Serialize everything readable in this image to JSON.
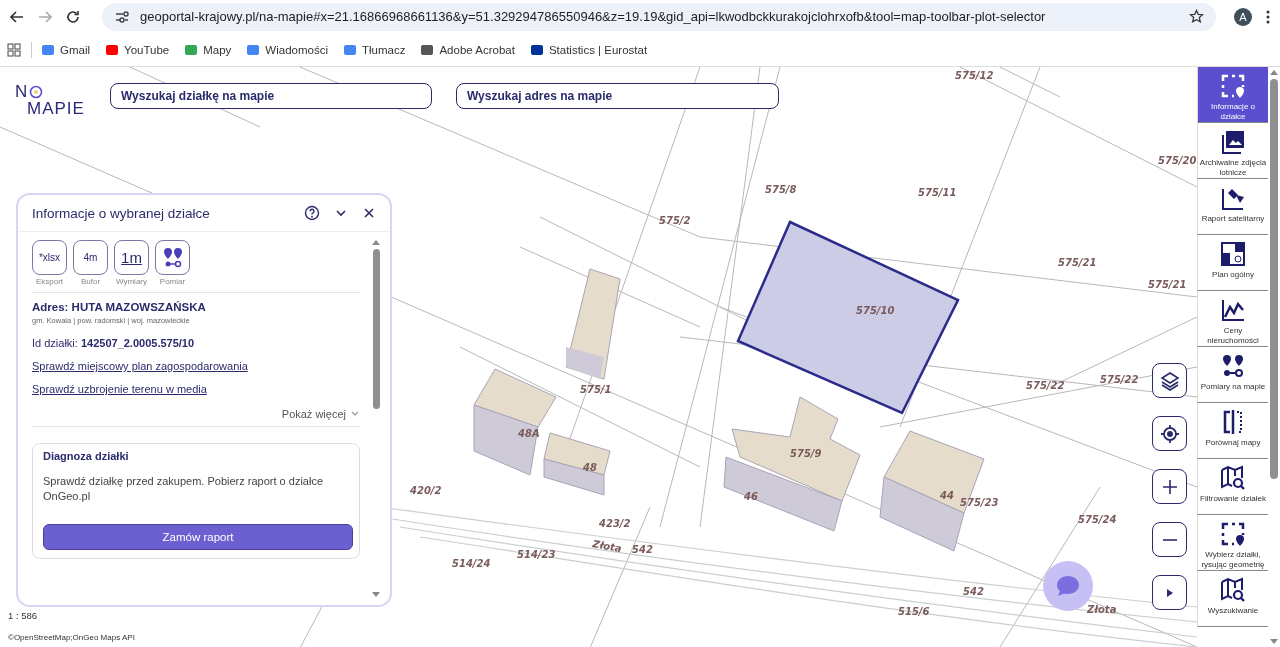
{
  "browser": {
    "url": "geoportal-krajowy.pl/na-mapie#x=21.16866968661136&y=51.329294786550946&z=19.19&gid_api=lkwodbckkurakojclohrxofb&tool=map-toolbar-plot-selector",
    "avatar": "A",
    "bookmarks": [
      "Gmail",
      "YouTube",
      "Mapy",
      "Wiadomości",
      "Tłumacz",
      "Adobe Acrobat",
      "Statistics | Eurostat"
    ]
  },
  "logo": {
    "top": "N",
    "bottom": "MAPIE"
  },
  "search_fields": [
    {
      "placeholder": "Wyszukaj działkę na mapie"
    },
    {
      "placeholder": "Wyszukaj adres na mapie"
    }
  ],
  "panel": {
    "title": "Informacje o wybranej działce",
    "tools": [
      {
        "value": "*xlsx",
        "caption": "Eksport"
      },
      {
        "value": "4m",
        "caption": "Bufor"
      },
      {
        "value": "1m",
        "caption": "Wymiary"
      },
      {
        "caption": "Pomiar"
      }
    ],
    "address": "Adres: HUTA MAZOWSZAŃSKA",
    "region": "gm. Kowala | pow. radomski | woj. mazowieckie",
    "id_label": "Id działki:",
    "id_value": "142507_2.0005.575/10",
    "links": [
      "Sprawdź miejscowy plan zagospodarowania",
      "Sprawdź uzbrojenie terenu w media"
    ],
    "show_more": "Pokaż więcej",
    "diagnosis": {
      "title": "Diagnoza działki",
      "text": "Sprawdź działkę przed zakupem. Pobierz raport o działce OnGeo.pl",
      "button": "Zamów raport"
    }
  },
  "map_labels": [
    "575/12",
    "575/20",
    "575/2",
    "575/8",
    "575/11",
    "575/21",
    "575/21",
    "575/10",
    "575/1",
    "48A",
    "48",
    "575/9",
    "46",
    "44",
    "575/23",
    "575/22",
    "575/22",
    "575/24",
    "420/2",
    "423/2",
    "Złota",
    "542",
    "514/23",
    "514/24",
    "542",
    "515/6",
    "Złota"
  ],
  "scale": "1 : 586",
  "attribution": "©OpenStreetMap;OnGeo Maps API",
  "sidebar": [
    {
      "label": "Informacje o działce",
      "selected": true
    },
    {
      "label": "Archiwalne zdjęcia lotnicze",
      "selected": false
    },
    {
      "label": "Raport satelitarny",
      "selected": false
    },
    {
      "label": "Plan ogólny",
      "selected": false
    },
    {
      "label": "Ceny nieruchomości",
      "selected": false
    },
    {
      "label": "Pomiary na mapie",
      "selected": false
    },
    {
      "label": "Porównaj mapy",
      "selected": false
    },
    {
      "label": "Filtrowanie działek",
      "selected": false
    },
    {
      "label": "Wybierz działki, rysując geometrię",
      "selected": false
    },
    {
      "label": "Wyszukiwanie",
      "selected": false
    }
  ]
}
